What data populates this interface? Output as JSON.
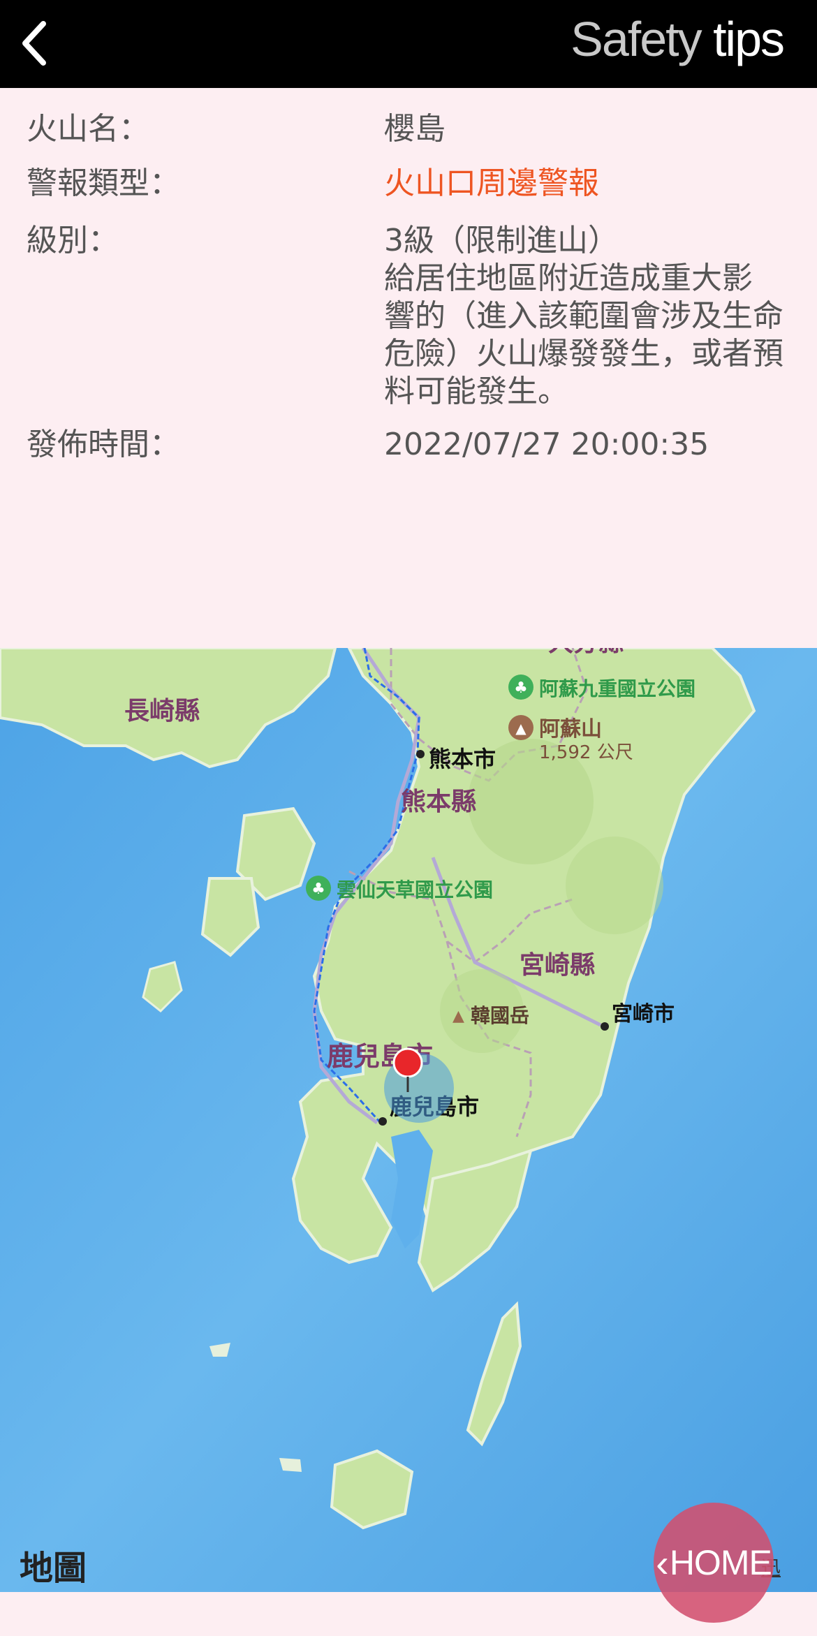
{
  "header": {
    "brand_light": "Safety",
    "brand_bold": "tips"
  },
  "info": {
    "volcano_label": "火山名：",
    "volcano_value": "櫻島",
    "alert_type_label": "警報類型：",
    "alert_type_value": "火山口周邊警報",
    "level_label": "級別：",
    "level_value": "3級（限制進山）",
    "level_desc_lines": [
      "給居住地區附近造成重大影",
      "響的（進入該範圍會涉及生命",
      "危險）火山爆發發生，或者預",
      "料可能發生。"
    ],
    "issued_label": "發佈時間：",
    "issued_value": "2022/07/27 20:00:35"
  },
  "map": {
    "labels": {
      "oita": "大分縣",
      "aso_park": "阿蘇九重國立公園",
      "aso_mountain": "阿蘇山",
      "aso_elevation": "1,592 公尺",
      "nagasaki": "長崎縣",
      "kumamoto_city": "熊本市",
      "kumamoto_pref": "熊本縣",
      "unzen_park": "雲仙天草國立公園",
      "miyazaki_pref": "宮崎縣",
      "karakuni": "韓國岳",
      "miyazaki_city": "宮崎市",
      "kagoshima_pref_area": "鹿兒島市",
      "kagoshima_city": "鹿兒島市"
    },
    "attribution": "地圖",
    "legal": "迅",
    "colors": {
      "sea": "#5fb0ec",
      "land": "#c9e6a6",
      "pin": "#e8262a"
    }
  },
  "home_button": {
    "label": "HOME"
  }
}
